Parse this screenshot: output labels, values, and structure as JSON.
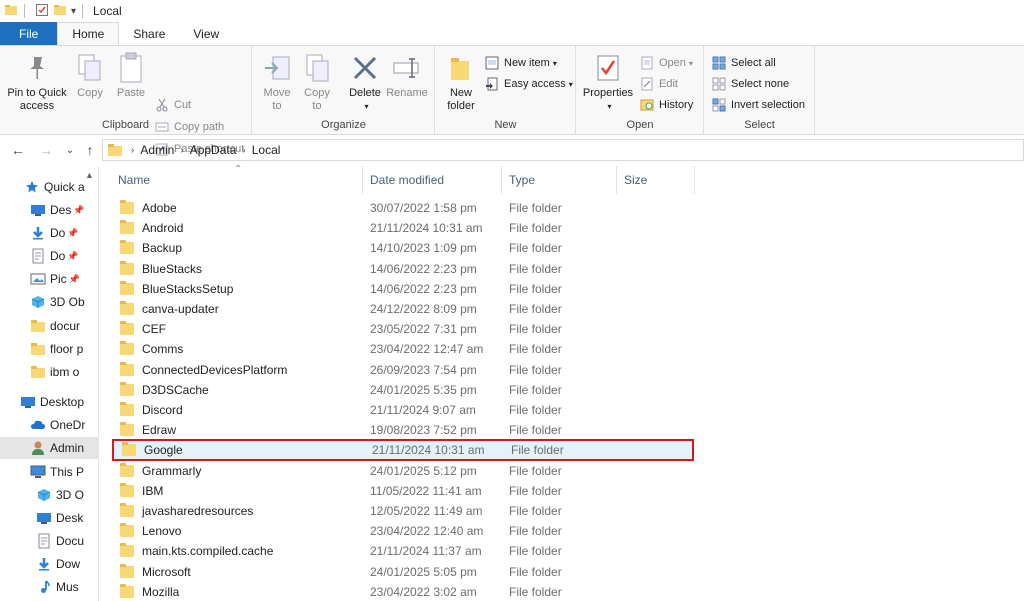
{
  "titlebar": {
    "title": "Local"
  },
  "tabs": [
    {
      "label": "File"
    },
    {
      "label": "Home"
    },
    {
      "label": "Share"
    },
    {
      "label": "View"
    }
  ],
  "ribbon": {
    "clipboard": {
      "label": "Clipboard",
      "pin": "Pin to Quick access",
      "copy": "Copy",
      "paste": "Paste",
      "cut": "Cut",
      "copy_path": "Copy path",
      "paste_shortcut": "Paste shortcut"
    },
    "organize": {
      "label": "Organize",
      "move_to": "Move to",
      "copy_to": "Copy to",
      "delete": "Delete",
      "rename": "Rename"
    },
    "new": {
      "label": "New",
      "new_folder": "New folder",
      "new_item": "New item",
      "easy_access": "Easy access"
    },
    "open": {
      "label": "Open",
      "properties": "Properties",
      "open": "Open",
      "edit": "Edit",
      "history": "History"
    },
    "select": {
      "label": "Select",
      "select_all": "Select all",
      "select_none": "Select none",
      "invert_selection": "Invert selection"
    }
  },
  "address": {
    "crumbs": [
      "Admin",
      "AppData",
      "Local"
    ]
  },
  "navpane": {
    "items": [
      {
        "label": "Quick a",
        "icon": "star-icon"
      },
      {
        "label": "Des",
        "icon": "desktop-icon",
        "pinned": true
      },
      {
        "label": "Do",
        "icon": "download-icon",
        "pinned": true
      },
      {
        "label": "Do",
        "icon": "document-icon",
        "pinned": true
      },
      {
        "label": "Pic",
        "icon": "pictures-icon",
        "pinned": true
      },
      {
        "label": "3D Ob",
        "icon": "cube-icon"
      },
      {
        "label": "docur",
        "icon": "folder-icon"
      },
      {
        "label": "floor p",
        "icon": "folder-icon"
      },
      {
        "label": "ibm o",
        "icon": "folder-icon"
      },
      {
        "label": "Desktop",
        "icon": "desktop-icon"
      },
      {
        "label": "OneDr",
        "icon": "cloud-icon"
      },
      {
        "label": "Admin",
        "icon": "user-icon"
      },
      {
        "label": "This P",
        "icon": "computer-icon"
      },
      {
        "label": "3D O",
        "icon": "cube-icon"
      },
      {
        "label": "Desk",
        "icon": "desktop-icon"
      },
      {
        "label": "Docu",
        "icon": "document-icon"
      },
      {
        "label": "Dow",
        "icon": "download-icon"
      },
      {
        "label": "Mus",
        "icon": "music-icon"
      }
    ]
  },
  "columns": {
    "name": "Name",
    "date": "Date modified",
    "type": "Type",
    "size": "Size"
  },
  "files": [
    {
      "name": "Adobe",
      "date": "30/07/2022 1:58 pm",
      "type": "File folder"
    },
    {
      "name": "Android",
      "date": "21/11/2024 10:31 am",
      "type": "File folder"
    },
    {
      "name": "Backup",
      "date": "14/10/2023 1:09 pm",
      "type": "File folder"
    },
    {
      "name": "BlueStacks",
      "date": "14/06/2022 2:23 pm",
      "type": "File folder"
    },
    {
      "name": "BlueStacksSetup",
      "date": "14/06/2022 2:23 pm",
      "type": "File folder"
    },
    {
      "name": "canva-updater",
      "date": "24/12/2022 8:09 pm",
      "type": "File folder"
    },
    {
      "name": "CEF",
      "date": "23/05/2022 7:31 pm",
      "type": "File folder"
    },
    {
      "name": "Comms",
      "date": "23/04/2022 12:47 am",
      "type": "File folder"
    },
    {
      "name": "ConnectedDevicesPlatform",
      "date": "26/09/2023 7:54 pm",
      "type": "File folder"
    },
    {
      "name": "D3DSCache",
      "date": "24/01/2025 5:35 pm",
      "type": "File folder"
    },
    {
      "name": "Discord",
      "date": "21/11/2024 9:07 am",
      "type": "File folder"
    },
    {
      "name": "Edraw",
      "date": "19/08/2023 7:52 pm",
      "type": "File folder"
    },
    {
      "name": "Google",
      "date": "21/11/2024 10:31 am",
      "type": "File folder",
      "selected": true
    },
    {
      "name": "Grammarly",
      "date": "24/01/2025 5:12 pm",
      "type": "File folder"
    },
    {
      "name": "IBM",
      "date": "11/05/2022 11:41 am",
      "type": "File folder"
    },
    {
      "name": "javasharedresources",
      "date": "12/05/2022 11:49 am",
      "type": "File folder"
    },
    {
      "name": "Lenovo",
      "date": "23/04/2022 12:40 am",
      "type": "File folder"
    },
    {
      "name": "main.kts.compiled.cache",
      "date": "21/11/2024 11:37 am",
      "type": "File folder"
    },
    {
      "name": "Microsoft",
      "date": "24/01/2025 5:05 pm",
      "type": "File folder"
    },
    {
      "name": "Mozilla",
      "date": "23/04/2022 3:02 am",
      "type": "File folder"
    }
  ],
  "colors": {
    "accent": "#1f6fbf",
    "selection_bg": "#e5f1fb",
    "highlight_border": "#d11b1b",
    "folder": "#f8d775"
  }
}
